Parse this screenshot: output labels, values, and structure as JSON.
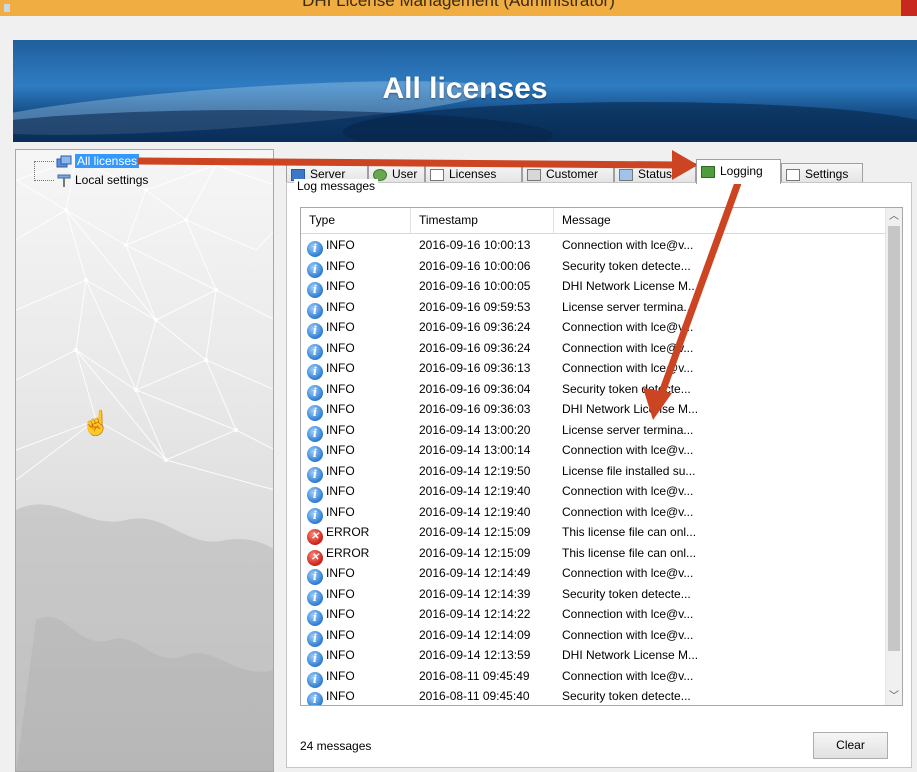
{
  "window": {
    "title": "DHI License Management (Administrator)"
  },
  "banner": {
    "title": "All licenses"
  },
  "tree": {
    "items": [
      {
        "label": "All licenses",
        "icon": "licenses-icon",
        "selected": true
      },
      {
        "label": "Local settings",
        "icon": "settings-tree-icon"
      }
    ]
  },
  "tabs": [
    {
      "label": "Server",
      "icon": "server-icon"
    },
    {
      "label": "User",
      "icon": "user-icon"
    },
    {
      "label": "Licenses",
      "icon": "licenses-tab-icon"
    },
    {
      "label": "Customer",
      "icon": "customer-icon"
    },
    {
      "label": "Status",
      "icon": "status-icon"
    },
    {
      "label": "Logging",
      "icon": "logging-icon",
      "active": true
    },
    {
      "label": "Settings",
      "icon": "settings-icon"
    }
  ],
  "log": {
    "group_label": "Log messages",
    "columns": {
      "type": "Type",
      "timestamp": "Timestamp",
      "message": "Message"
    },
    "rows": [
      {
        "type": "INFO",
        "ts": "2016-09-16 10:00:13",
        "msg": "Connection with lce@v..."
      },
      {
        "type": "INFO",
        "ts": "2016-09-16 10:00:06",
        "msg": "Security token detecte..."
      },
      {
        "type": "INFO",
        "ts": "2016-09-16 10:00:05",
        "msg": "DHI Network License M..."
      },
      {
        "type": "INFO",
        "ts": "2016-09-16 09:59:53",
        "msg": "License server termina..."
      },
      {
        "type": "INFO",
        "ts": "2016-09-16 09:36:24",
        "msg": "Connection with lce@v..."
      },
      {
        "type": "INFO",
        "ts": "2016-09-16 09:36:24",
        "msg": "Connection with lce@v..."
      },
      {
        "type": "INFO",
        "ts": "2016-09-16 09:36:13",
        "msg": "Connection with lce@v..."
      },
      {
        "type": "INFO",
        "ts": "2016-09-16 09:36:04",
        "msg": "Security token detecte..."
      },
      {
        "type": "INFO",
        "ts": "2016-09-16 09:36:03",
        "msg": "DHI Network License M..."
      },
      {
        "type": "INFO",
        "ts": "2016-09-14 13:00:20",
        "msg": "License server termina..."
      },
      {
        "type": "INFO",
        "ts": "2016-09-14 13:00:14",
        "msg": "Connection with lce@v..."
      },
      {
        "type": "INFO",
        "ts": "2016-09-14 12:19:50",
        "msg": "License file installed su..."
      },
      {
        "type": "INFO",
        "ts": "2016-09-14 12:19:40",
        "msg": "Connection with lce@v..."
      },
      {
        "type": "INFO",
        "ts": "2016-09-14 12:19:40",
        "msg": "Connection with lce@v..."
      },
      {
        "type": "ERROR",
        "ts": "2016-09-14 12:15:09",
        "msg": "This license file can onl..."
      },
      {
        "type": "ERROR",
        "ts": "2016-09-14 12:15:09",
        "msg": "This license file can onl..."
      },
      {
        "type": "INFO",
        "ts": "2016-09-14 12:14:49",
        "msg": "Connection with lce@v..."
      },
      {
        "type": "INFO",
        "ts": "2016-09-14 12:14:39",
        "msg": "Security token detecte..."
      },
      {
        "type": "INFO",
        "ts": "2016-09-14 12:14:22",
        "msg": "Connection with lce@v..."
      },
      {
        "type": "INFO",
        "ts": "2016-09-14 12:14:09",
        "msg": "Connection with lce@v..."
      },
      {
        "type": "INFO",
        "ts": "2016-09-14 12:13:59",
        "msg": "DHI Network License M..."
      },
      {
        "type": "INFO",
        "ts": "2016-08-11 09:45:49",
        "msg": "Connection with lce@v..."
      },
      {
        "type": "INFO",
        "ts": "2016-08-11 09:45:40",
        "msg": "Security token detecte..."
      }
    ],
    "count_label": "24 messages",
    "clear_label": "Clear"
  },
  "colors": {
    "annotation_arrow": "#cc4422",
    "selection": "#3399ff",
    "title_bar": "#f0ad42"
  }
}
